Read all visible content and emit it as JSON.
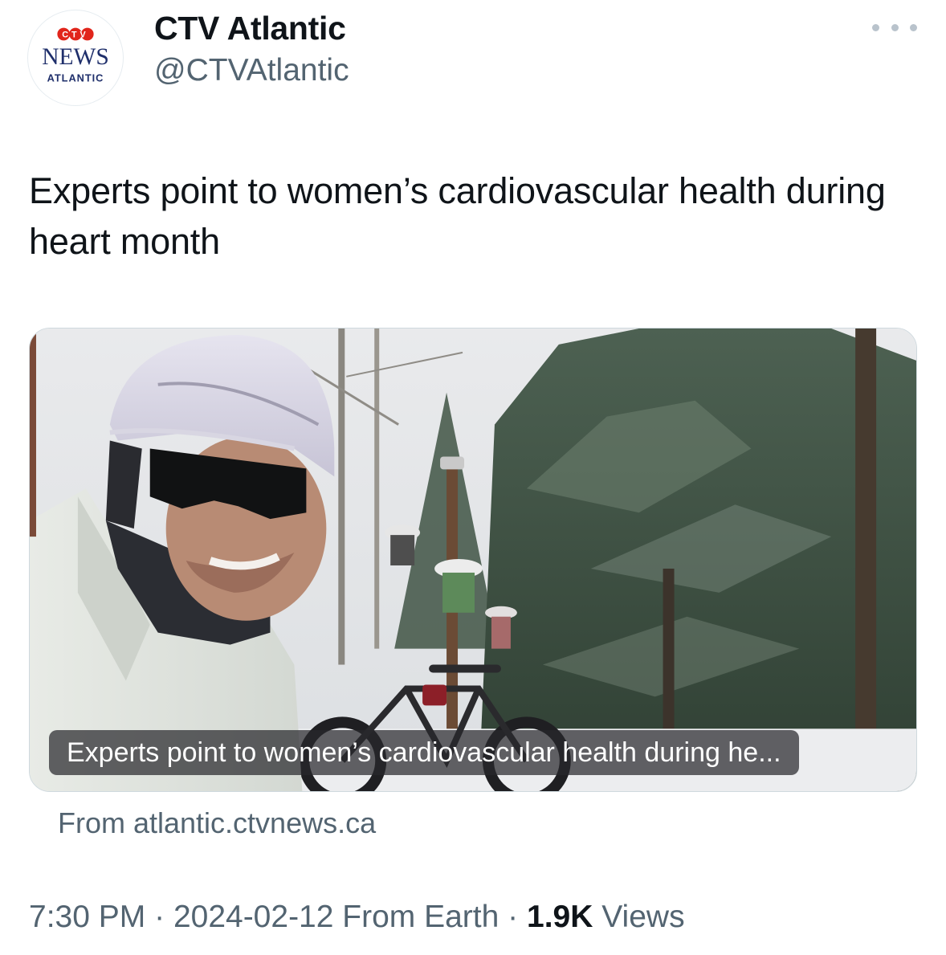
{
  "author": {
    "display_name": "CTV Atlantic",
    "handle": "@CTVAtlantic",
    "avatar_logo": {
      "brand_top": "CTV",
      "brand_main": "NEWS",
      "brand_sub": "ATLANTIC"
    }
  },
  "tweet": {
    "text": "Experts point to women’s cardiovascular health during heart month"
  },
  "card": {
    "caption": "Experts point to women’s cardiovascular health during he...",
    "source": "From atlantic.ctvnews.ca"
  },
  "meta": {
    "time": "7:30 PM",
    "separator": "·",
    "date": "2024-02-12",
    "location": "From Earth",
    "views_count": "1.9K",
    "views_label": "Views"
  },
  "colors": {
    "primary_text": "#0f1419",
    "secondary_text": "#536471",
    "ctv_red": "#e1251b",
    "ctv_blue": "#1f2f6b"
  },
  "icons": {
    "more": "more-horizontal-icon"
  }
}
